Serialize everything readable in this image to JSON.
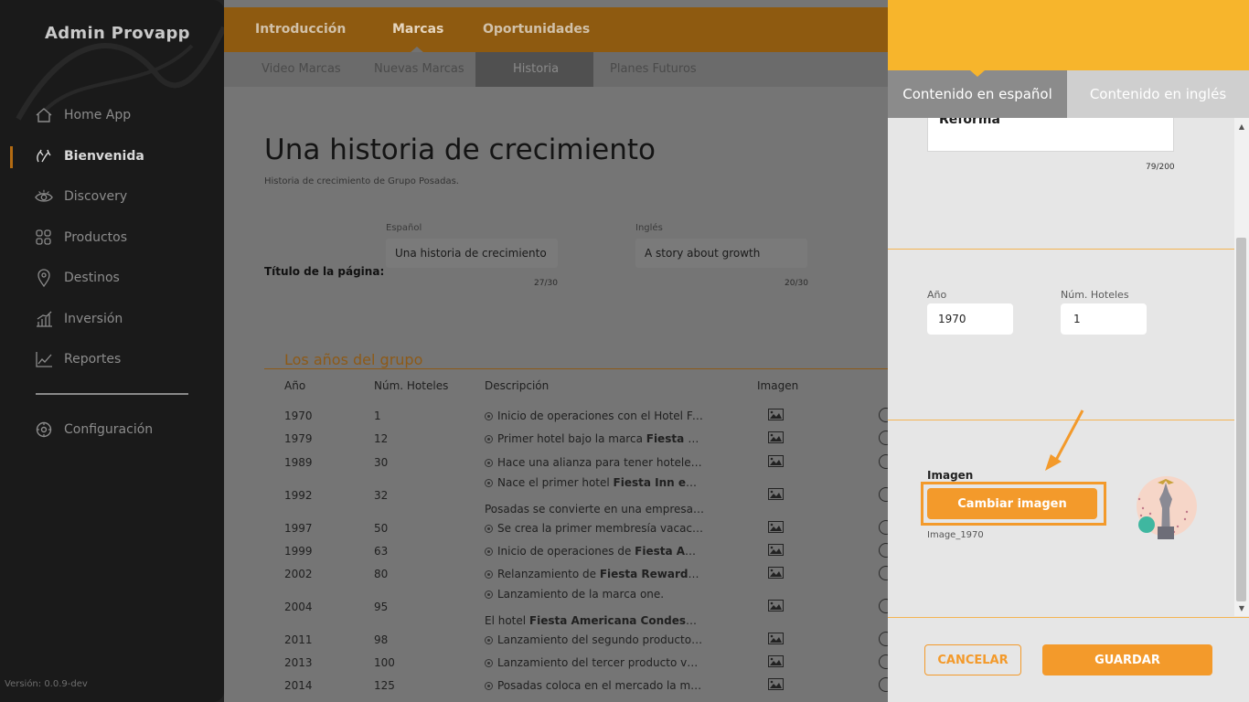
{
  "sidebar": {
    "brand": "Admin Provapp",
    "items": [
      {
        "label": "Home App",
        "icon": "home-icon"
      },
      {
        "label": "Bienvenida",
        "icon": "hands-icon"
      },
      {
        "label": "Discovery",
        "icon": "eye-icon"
      },
      {
        "label": "Productos",
        "icon": "grid-icon"
      },
      {
        "label": "Destinos",
        "icon": "location-pin-icon"
      },
      {
        "label": "Inversión",
        "icon": "bar-chart-icon"
      },
      {
        "label": "Reportes",
        "icon": "line-chart-icon"
      }
    ],
    "settings": {
      "label": "Configuración",
      "icon": "gear-icon"
    },
    "version": "Versión: 0.0.9-dev"
  },
  "main": {
    "tabs": [
      "Introducción",
      "Marcas",
      "Oportunidades"
    ],
    "subtabs": [
      "Video Marcas",
      "Nuevas Marcas",
      "Historia",
      "Planes Futuros"
    ],
    "page_title": "Una historia de crecimiento",
    "page_subtitle": "Historia de crecimiento de Grupo Posadas.",
    "title_field": {
      "label": "Título de la página:",
      "es_label": "Español",
      "es_value": "Una historia de crecimiento",
      "es_count": "27/30",
      "en_label": "Inglés",
      "en_value": "A story about growth",
      "en_count": "20/30"
    },
    "section_title": "Los años del grupo",
    "table": {
      "headers": [
        "Año",
        "Núm. Hoteles",
        "Descripción",
        "Imagen"
      ],
      "rows": [
        {
          "year": "1970",
          "hotels": "1",
          "desc": [
            [
              "Inicio de operaciones con el Hotel Fi...",
              ""
            ]
          ]
        },
        {
          "year": "1979",
          "hotels": "12",
          "desc": [
            [
              "Primer hotel bajo la marca ",
              "Fiesta A..."
            ]
          ]
        },
        {
          "year": "1989",
          "hotels": "30",
          "desc": [
            [
              "Hace una alianza para tener hoteles ...",
              ""
            ]
          ]
        },
        {
          "year": "1992",
          "hotels": "32",
          "desc": [
            [
              "Nace el primer hotel ",
              "Fiesta Inn en C..."
            ]
          ],
          "extra": "Posadas se convierte en una empresa ..."
        },
        {
          "year": "1997",
          "hotels": "50",
          "desc": [
            [
              "Se crea la primer membresía vacacio...",
              ""
            ]
          ]
        },
        {
          "year": "1999",
          "hotels": "63",
          "desc": [
            [
              "Inicio de operaciones de ",
              "Fiesta Ame..."
            ]
          ]
        },
        {
          "year": "2002",
          "hotels": "80",
          "desc": [
            [
              "Relanzamiento de ",
              "Fiesta Rewards",
              " e..."
            ]
          ]
        },
        {
          "year": "2004",
          "hotels": "95",
          "desc": [
            [
              "Lanzamiento de la marca one.",
              ""
            ]
          ],
          "extra_pre": "El hotel ",
          "extra_bold": "Fiesta Americana Condesa A..."
        },
        {
          "year": "2011",
          "hotels": "98",
          "desc": [
            [
              "Lanzamiento del segundo producto v...",
              ""
            ]
          ]
        },
        {
          "year": "2013",
          "hotels": "100",
          "desc": [
            [
              "Lanzamiento del tercer producto vac...",
              ""
            ]
          ]
        },
        {
          "year": "2014",
          "hotels": "125",
          "desc": [
            [
              "Posadas coloca en el mercado la ma...",
              ""
            ]
          ]
        }
      ]
    }
  },
  "panel": {
    "tab_es": "Contenido en español",
    "tab_en": "Contenido en inglés",
    "text_fragment": "Americana Reforma",
    "text_fragment_tail": ".",
    "text_count": "79/200",
    "year_label": "Año",
    "year_value": "1970",
    "hotels_label": "Núm. Hoteles",
    "hotels_value": "1",
    "image_label": "Imagen",
    "change_image_button": "Cambiar imagen",
    "image_name": "Image_1970",
    "cancel_button": "CANCELAR",
    "save_button": "GUARDAR"
  },
  "colors": {
    "accent": "#f39a2b",
    "panel_header": "#f7b52c",
    "sidebar_bg": "#1a1a1a"
  }
}
